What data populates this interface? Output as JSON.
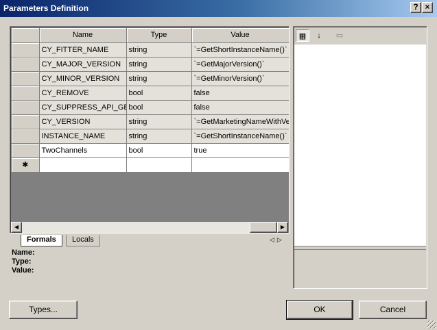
{
  "window": {
    "title": "Parameters Definition",
    "help_glyph": "?",
    "close_glyph": "×"
  },
  "grid": {
    "columns": [
      "Name",
      "Type",
      "Value"
    ],
    "rows": [
      {
        "name": "CY_FITTER_NAME",
        "type": "string",
        "value": "`=GetShortInstanceName()`"
      },
      {
        "name": "CY_MAJOR_VERSION",
        "type": "string",
        "value": "`=GetMajorVersion()`"
      },
      {
        "name": "CY_MINOR_VERSION",
        "type": "string",
        "value": "`=GetMinorVersion()`"
      },
      {
        "name": "CY_REMOVE",
        "type": "bool",
        "value": "false"
      },
      {
        "name": "CY_SUPPRESS_API_GEN",
        "type": "bool",
        "value": "false"
      },
      {
        "name": "CY_VERSION",
        "type": "string",
        "value": "`=GetMarketingNameWithVersion()`"
      },
      {
        "name": "INSTANCE_NAME",
        "type": "string",
        "value": "`=GetShortInstanceName()`"
      },
      {
        "name": "TwoChannels",
        "type": "bool",
        "value": "true"
      }
    ],
    "new_row_marker": "✱"
  },
  "tabs": {
    "formals": "Formals",
    "locals": "Locals"
  },
  "info": {
    "name_label": "Name:",
    "type_label": "Type:",
    "value_label": "Value:"
  },
  "buttons": {
    "types": "Types...",
    "ok": "OK",
    "cancel": "Cancel"
  },
  "colors": {
    "title_gradient_start": "#0a246a",
    "title_gradient_end": "#a6caf0",
    "dialog_face": "#d4d0c8",
    "grid_empty": "#808080"
  }
}
